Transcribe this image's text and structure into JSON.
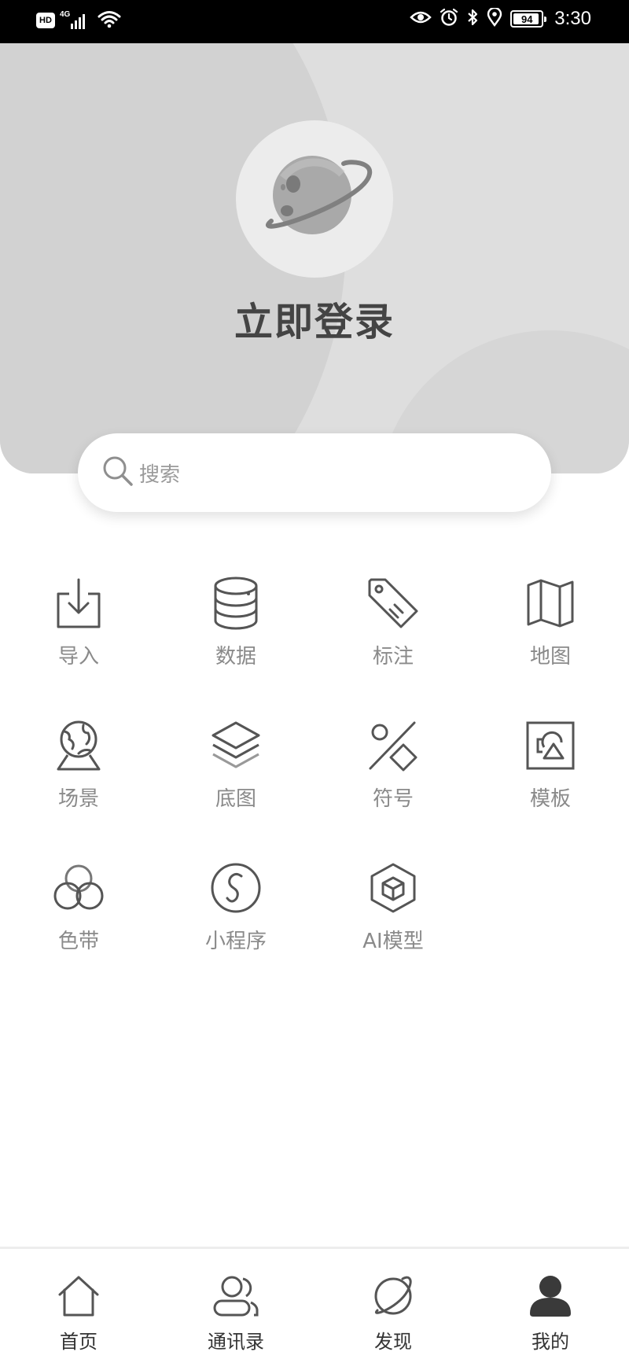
{
  "status_bar": {
    "hd": "HD",
    "network": "4G",
    "battery": "94",
    "battery_level": 0.94,
    "time": "3:30"
  },
  "header": {
    "login_title": "立即登录"
  },
  "search": {
    "placeholder": "搜索"
  },
  "functions": [
    {
      "label": "导入",
      "icon": "import-icon"
    },
    {
      "label": "数据",
      "icon": "database-icon"
    },
    {
      "label": "标注",
      "icon": "tag-icon"
    },
    {
      "label": "地图",
      "icon": "map-icon"
    },
    {
      "label": "场景",
      "icon": "globe-scene-icon"
    },
    {
      "label": "底图",
      "icon": "layers-icon"
    },
    {
      "label": "符号",
      "icon": "symbol-icon"
    },
    {
      "label": "模板",
      "icon": "template-icon"
    },
    {
      "label": "色带",
      "icon": "color-band-icon"
    },
    {
      "label": "小程序",
      "icon": "mini-program-icon"
    },
    {
      "label": "AI模型",
      "icon": "ai-model-cube-icon"
    }
  ],
  "tabbar": [
    {
      "label": "首页",
      "icon": "home-icon",
      "active": false
    },
    {
      "label": "通讯录",
      "icon": "contacts-icon",
      "active": false
    },
    {
      "label": "发现",
      "icon": "discover-planet-icon",
      "active": false
    },
    {
      "label": "我的",
      "icon": "profile-icon",
      "active": true
    }
  ]
}
